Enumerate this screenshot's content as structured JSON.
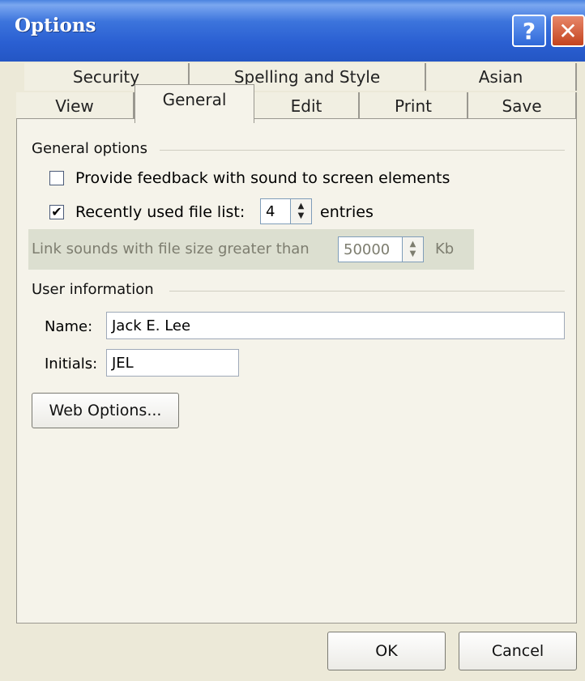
{
  "window": {
    "title": "Options"
  },
  "titlebar": {
    "help_label": "?",
    "close_label": "✕"
  },
  "tabs": {
    "row1": [
      {
        "label": "Security"
      },
      {
        "label": "Spelling and Style"
      },
      {
        "label": "Asian"
      }
    ],
    "row2": [
      {
        "label": "View"
      },
      {
        "label": "General",
        "active": true
      },
      {
        "label": "Edit"
      },
      {
        "label": "Print"
      },
      {
        "label": "Save"
      }
    ]
  },
  "general_options": {
    "section_title": "General options",
    "feedback_sound": {
      "label": "Provide feedback with sound to screen elements",
      "checked": false
    },
    "recent_files": {
      "label": "Recently used file list:",
      "checked": true,
      "value": "4",
      "suffix": "entries"
    },
    "link_sounds": {
      "label": "Link sounds with file size greater than",
      "value": "50000",
      "unit": "Kb",
      "enabled": false
    }
  },
  "user_information": {
    "section_title": "User information",
    "name_label": "Name:",
    "name_value": "Jack E. Lee",
    "initials_label": "Initials:",
    "initials_value": "JEL"
  },
  "buttons": {
    "web_options": "Web Options...",
    "ok": "OK",
    "cancel": "Cancel"
  },
  "icons": {
    "check": "✔",
    "spin_up": "▲",
    "spin_down": "▼"
  }
}
